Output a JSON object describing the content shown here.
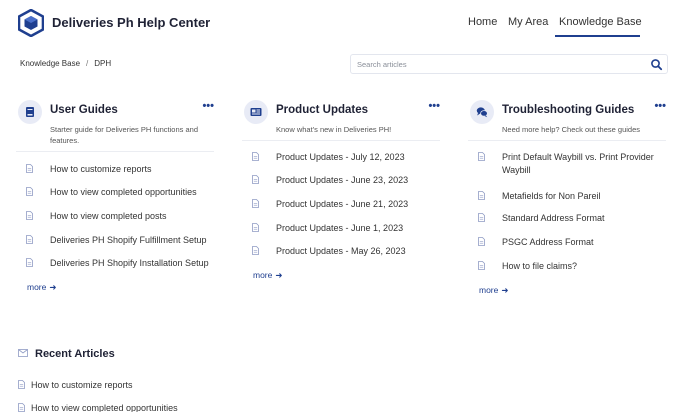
{
  "header": {
    "brand": "Deliveries Ph Help Center",
    "nav": [
      "Home",
      "My Area",
      "Knowledge Base"
    ],
    "active_nav": "Knowledge Base"
  },
  "breadcrumb": [
    "Knowledge Base",
    "DPH"
  ],
  "breadcrumb_separator": "/",
  "search": {
    "placeholder": "Search articles",
    "value": ""
  },
  "categories": [
    {
      "title": "User Guides",
      "description": "Starter guide for Deliveries PH functions and features.",
      "icon": "book-icon",
      "articles": [
        "How to customize reports",
        "How to view completed opportunities",
        "How to view completed posts",
        "Deliveries PH Shopify Fulfillment Setup",
        "Deliveries PH Shopify Installation Setup"
      ],
      "more": "more"
    },
    {
      "title": "Product Updates",
      "description": "Know what's new in Deliveries PH!",
      "icon": "newspaper-icon",
      "articles": [
        "Product Updates - July 12, 2023",
        "Product Updates - June 23, 2023",
        "Product Updates - June 21, 2023",
        "Product Updates - June 1, 2023",
        "Product Updates - May 26, 2023"
      ],
      "more": "more"
    },
    {
      "title": "Troubleshooting Guides",
      "description": "Need more help? Check out these guides",
      "icon": "chat-icon",
      "articles": [
        "Print Default Waybill vs. Print Provider Waybill",
        "Metafields for Non Pareil",
        "Standard Address Format",
        "PSGC Address Format",
        "How to file claims?"
      ],
      "more": "more"
    }
  ],
  "recent": {
    "title": "Recent Articles",
    "articles": [
      "How to customize reports",
      "How to view completed opportunities"
    ]
  },
  "colors": {
    "accent": "#1f3f8f",
    "icon_bg": "#e8ebf6",
    "doc_icon": "#8f9bc4",
    "text": "#333333",
    "title": "#1f2235"
  }
}
